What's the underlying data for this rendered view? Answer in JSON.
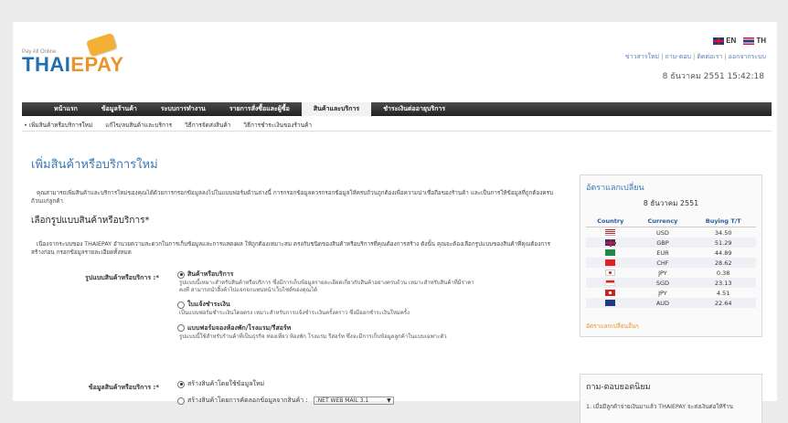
{
  "brand": {
    "tagline": "Pay All Online",
    "name_part1": "THAI",
    "name_part2": "EPAY"
  },
  "lang": {
    "en": "EN",
    "th": "TH"
  },
  "toplinks": [
    "ข่าวสารใหม่",
    "ถาม-ตอบ",
    "ติดต่อเรา",
    "ออกจากระบบ"
  ],
  "datetime": "8 ธันวาคม 2551 15:42:18",
  "nav": [
    "หน้าแรก",
    "ข้อมูลร้านค้า",
    "ระบบการทำงาน",
    "รายการสั่งซื้อและผู้ซื้อ",
    "สินค้าและบริการ",
    "ชำระเงินต่ออายุบริการ"
  ],
  "nav_active": 4,
  "subnav": [
    "• เพิ่มสินค้าหรือบริการใหม่",
    "แก้ไข/ลบสินค้าและบริการ",
    "วิธีการจัดส่งสินค้า",
    "วิธีการชำระเงินของร้านค้า"
  ],
  "main": {
    "title": "เพิ่มสินค้าหรือบริการใหม่",
    "intro": "คุณสามารถเพิ่มสินค้าและบริการใหม่ของคุณได้ด้วยการกรอกข้อมูลลงไปในแบบฟอร์มด้านล่างนี้ การกรอกข้อมูลควรกรอกข้อมูลให้ครบถ้วนถูกต้องเพื่อความน่าเชื่อถือของร้านค้า และเป็นการให้ข้อมูลที่ถูกต้องครบถ้วนแก่ลูกค้า",
    "section_title": "เลือกรูปแบบสินค้าหรือบริการ*",
    "section_desc": "เนื่องจากระบบของ THAIEPAY อำนวยความสะดวกในการเก็บข้อมูลและการแสดงผล ให้ถูกต้องเหมาะสม ตรงกับชนิดของสินค้าหรือบริการที่คุณต้องการสร้าง ดังนั้น คุณจะต้องเลือกรูปแบบของสินค้าที่คุณต้องการสร้างก่อน กรอกข้อมูลรายละเอียดทั้งหมด",
    "type_label": "รูปแบบสินค้าหรือบริการ :*",
    "type_options": [
      {
        "title": "สินค้าหรือบริการ",
        "desc": "รูปแบบนี้เหมาะสำหรับสินค้าหรือบริการ ซึ่งมีการเก็บข้อมูลรายละเอียดเกี่ยวกับสินค้าอย่างครบถ้วน เหมาะสำหรับสินค้าที่มีราคาคงที่ สามารถนำสิ้งค้าไปแจกจกแทนหน้าเว็บไซต์ของคุณได้",
        "selected": true
      },
      {
        "title": "ใบแจ้งชำระเงิน",
        "desc": "เป็นแบบฟอร์มชำระเงินโดยตรง เหมาะสำหรับการแจ้งชำระเงินครั้งคราว ซึ่งมีออกชำระเงินใหม่ครั้ง",
        "selected": false
      },
      {
        "title": "แบบฟอร์มจองห้องพัก/โรงแรม/รีสอร์ท",
        "desc": "รูปแบบนี้ใช้สำหรับร้านค้าที่เป็นธุรกิจ ท่องเที่ยว ห้องพัก โรงแรม รีสอร์ท ซึ่งจะมีการเก็บข้อมูลลูกค้าในแบบเฉพาะตัว",
        "selected": false
      }
    ],
    "data_label": "ข้อมูลสินค้าหรือบริการ :*",
    "data_options": [
      {
        "title": "สร้างสินค้าโดยใช้ข้อมูลใหม่",
        "selected": true
      },
      {
        "title": "สร้างสินค้าโดยการคัดลอกข้อมูลจากสินค้า :",
        "selected": false
      }
    ],
    "copy_select_value": ".NET WEB MAIL 3.1"
  },
  "rates": {
    "title": "อัตราแลกเปลี่ยน",
    "date": "8 ธันวาคม 2551",
    "headers": [
      "Country",
      "Currency",
      "Buying T/T"
    ],
    "rows": [
      {
        "flag": "us-flag-icon",
        "currency": "USD",
        "rate": "34.50"
      },
      {
        "flag": "uk-flag-icon",
        "currency": "GBP",
        "rate": "51.29"
      },
      {
        "flag": "eu-flag-icon",
        "currency": "EUR",
        "rate": "44.89"
      },
      {
        "flag": "ch-flag-icon",
        "currency": "CHF",
        "rate": "28.62"
      },
      {
        "flag": "jp-flag-icon",
        "currency": "JPY",
        "rate": "0.38"
      },
      {
        "flag": "sg-flag-icon",
        "currency": "SGD",
        "rate": "23.13"
      },
      {
        "flag": "jp-flag-icon",
        "currency": "JPY",
        "rate": "4.51"
      },
      {
        "flag": "au-flag-icon",
        "currency": "AUD",
        "rate": "22.64"
      }
    ],
    "more_link": "อัตราแลกเปลี่ยนอื่นๆ"
  },
  "faq": {
    "title": "ถาม-ตอบยอดนิยม",
    "first_question": "1.  เมื่อมีลูกค้าจ่ายเงินมาแล้ว THAIEPAY จะส่งเงินต่อให้ร้าน"
  },
  "colors": {
    "brand_blue": "#1f6fb2",
    "brand_orange": "#e8952a",
    "link_blue": "#3a78b4"
  }
}
